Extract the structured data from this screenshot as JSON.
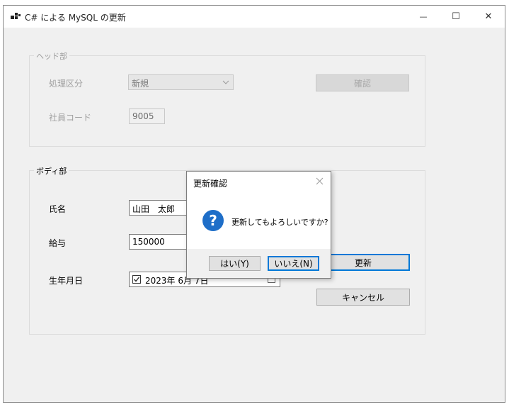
{
  "window": {
    "title": "C# による MySQL の更新",
    "minimize": "—",
    "maximize": "☐",
    "close": "✕"
  },
  "head_group": {
    "label": "ヘッド部",
    "process_label": "処理区分",
    "process_value": "新規",
    "confirm_button": "確認",
    "employee_code_label": "社員コード",
    "employee_code_value": "9005"
  },
  "body_group": {
    "label": "ボディ部",
    "name_label": "氏名",
    "name_value": "山田　太郎",
    "salary_label": "給与",
    "salary_value": "150000",
    "birthdate_label": "生年月日",
    "birthdate_value": "2023年  6月  7日",
    "birthdate_checked": true,
    "update_button": "更新",
    "cancel_button": "キャンセル"
  },
  "dialog": {
    "title": "更新確認",
    "message": "更新してもよろしいですか?",
    "yes_button": "はい(Y)",
    "no_button": "いいえ(N)"
  }
}
